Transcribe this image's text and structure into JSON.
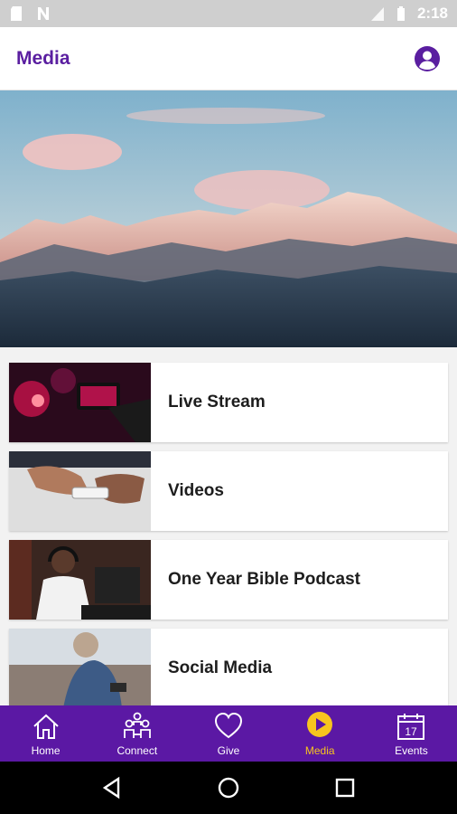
{
  "status_bar": {
    "time": "2:18"
  },
  "app_bar": {
    "title": "Media"
  },
  "hero": {
    "image": "mountain-range-at-sunset"
  },
  "media_items": [
    {
      "label": "Live Stream",
      "thumb": "phone-recording-concert"
    },
    {
      "label": "Videos",
      "thumb": "hands-holding-phone"
    },
    {
      "label": "One Year Bible Podcast",
      "thumb": "man-with-headphones-in-studio"
    },
    {
      "label": "Social Media",
      "thumb": "person-looking-at-phone"
    }
  ],
  "bottom_nav": {
    "items": [
      {
        "label": "Home",
        "icon": "home-icon"
      },
      {
        "label": "Connect",
        "icon": "people-icon"
      },
      {
        "label": "Give",
        "icon": "heart-icon"
      },
      {
        "label": "Media",
        "icon": "play-icon",
        "active": true
      },
      {
        "label": "Events",
        "icon": "calendar-icon"
      }
    ],
    "active_color": "#f7c51e",
    "background": "#5b18a4"
  },
  "calendar_day": "17",
  "colors": {
    "accent": "#5a1ea0"
  }
}
